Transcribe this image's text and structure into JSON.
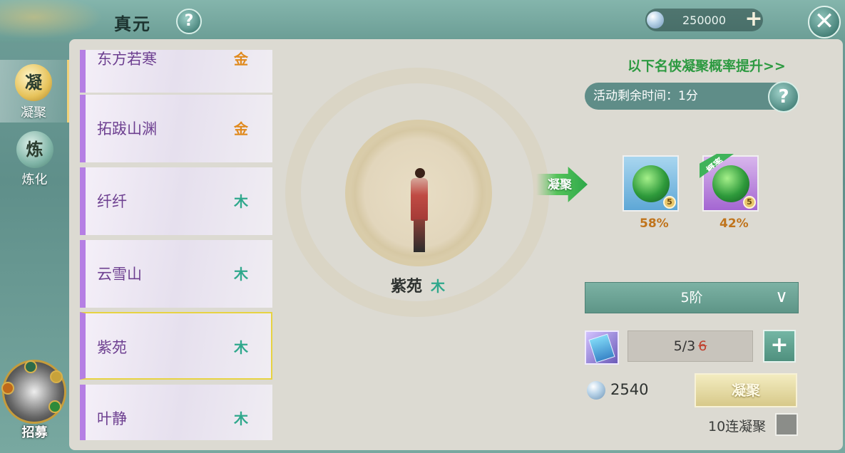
{
  "header": {
    "title": "真元",
    "currency_value": "250000",
    "plus_label": "+",
    "close_label": "✕",
    "help_label": "?"
  },
  "sidenav": {
    "items": [
      {
        "label": "凝聚",
        "icon": "凝"
      },
      {
        "label": "炼化",
        "icon": "炼"
      }
    ],
    "recruit_label": "招募"
  },
  "hero_list": [
    {
      "name": "东方若寒",
      "element": "金"
    },
    {
      "name": "拓跋山渊",
      "element": "金"
    },
    {
      "name": "纤纤",
      "element": "木"
    },
    {
      "name": "云雪山",
      "element": "木"
    },
    {
      "name": "紫苑",
      "element": "木"
    },
    {
      "name": "叶静",
      "element": "木"
    }
  ],
  "selected_hero": {
    "name": "紫苑",
    "element": "木"
  },
  "fuse_arrow_label": "凝聚",
  "boost_link": "以下名侠凝聚概率提升>>",
  "timer_text": "活动剩余时间：1分",
  "timer_help": "?",
  "rewards": [
    {
      "percent": "58%",
      "level": "5",
      "boosted": false
    },
    {
      "percent": "42%",
      "level": "5",
      "boosted": true,
      "ribbon": "概率"
    }
  ],
  "tier": {
    "selected": "5阶"
  },
  "consumable": {
    "count": "5/3",
    "previous": "6"
  },
  "cost": "2540",
  "fuse_button": "凝聚",
  "ten_fuse_label": "10连凝聚",
  "colors": {
    "accent_green": "#2d9a41",
    "rarity_purple": "#b57fe4",
    "gold_element": "#e08a1e",
    "wood_element": "#2fa88c"
  }
}
